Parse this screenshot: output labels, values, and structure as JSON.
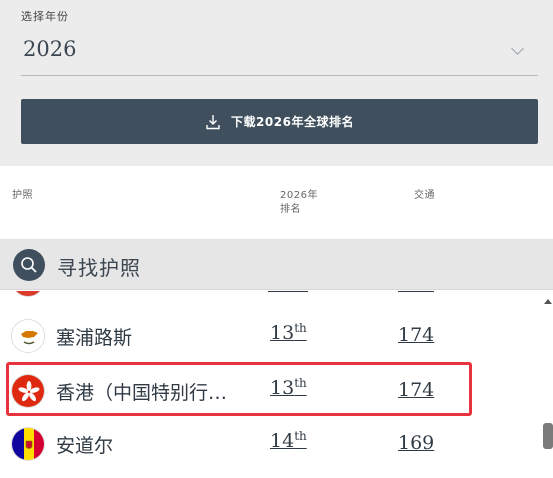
{
  "year_selector": {
    "label": "选择年份",
    "value": "2026"
  },
  "download_button": {
    "label": "下载2026年全球排名"
  },
  "table_headers": {
    "passport": "护照",
    "rank_line1": "2026年",
    "rank_line2": "排名",
    "visa_free": "交通"
  },
  "search": {
    "label": "寻找护照"
  },
  "rows": [
    {
      "country": "塞浦路斯",
      "rank": "13",
      "rank_suffix": "th",
      "score": "174",
      "flag": "cyprus-flag-icon"
    },
    {
      "country": "香港（中国特别行…",
      "rank": "13",
      "rank_suffix": "th",
      "score": "174",
      "flag": "hong-kong-flag-icon"
    },
    {
      "country": "安道尔",
      "rank": "14",
      "rank_suffix": "th",
      "score": "169",
      "flag": "andorra-flag-icon"
    }
  ],
  "colors": {
    "button_bg": "#3f4f5d",
    "highlight": "#e8333f",
    "panel_bg": "#ececec"
  }
}
